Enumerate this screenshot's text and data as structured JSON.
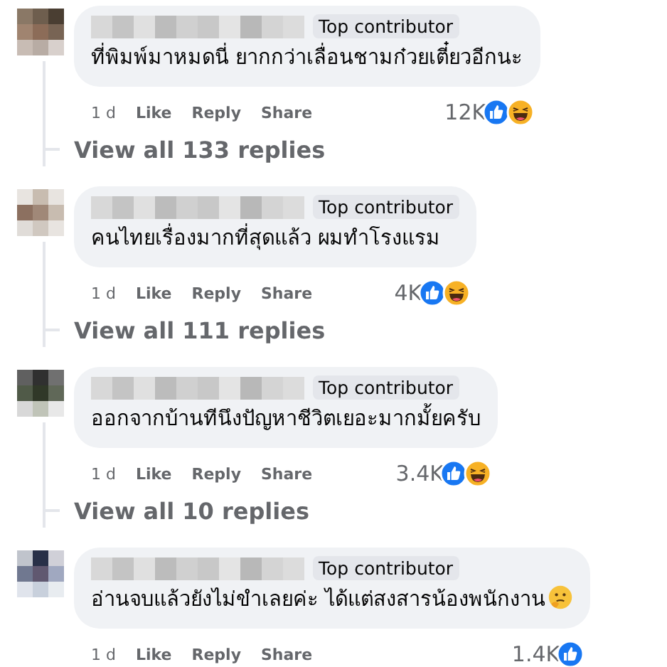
{
  "comments": [
    {
      "badge": "Top contributor",
      "text": "ที่พิมพ์มาหมดนี่ ยากกว่าเลื่อนชามก๋วยเตี๋ยวอีกนะ",
      "emoji": false,
      "time": "1 d",
      "actions": [
        "Like",
        "Reply",
        "Share"
      ],
      "reaction_count": "12K",
      "reactions": [
        {
          "kind": "like"
        },
        {
          "kind": "haha"
        }
      ],
      "view_replies": "View all 133 replies"
    },
    {
      "badge": "Top contributor",
      "text": "คนไทยเรื่องมากที่สุดแล้ว ผมทำโรงแรม",
      "emoji": false,
      "time": "1 d",
      "actions": [
        "Like",
        "Reply",
        "Share"
      ],
      "reaction_count": "4K",
      "reactions": [
        {
          "kind": "like"
        },
        {
          "kind": "haha"
        }
      ],
      "view_replies": "View all 111 replies"
    },
    {
      "badge": "Top contributor",
      "text": "ออกจากบ้านทีนึงปัญหาชีวิตเยอะมากมั้ยครับ",
      "emoji": false,
      "time": "1 d",
      "actions": [
        "Like",
        "Reply",
        "Share"
      ],
      "reaction_count": "3.4K",
      "reactions": [
        {
          "kind": "like"
        },
        {
          "kind": "haha"
        }
      ],
      "view_replies": "View all 10 replies"
    },
    {
      "badge": "Top contributor",
      "text": "อ่านจบแล้วยังไม่ขำเลยค่ะ ได้แต่สงสารน้องพนักงาน",
      "emoji": true,
      "time": "1 d",
      "actions": [
        "Like",
        "Reply",
        "Share"
      ],
      "reaction_count": "1.4K",
      "reactions": [
        {
          "kind": "like"
        }
      ]
    }
  ]
}
